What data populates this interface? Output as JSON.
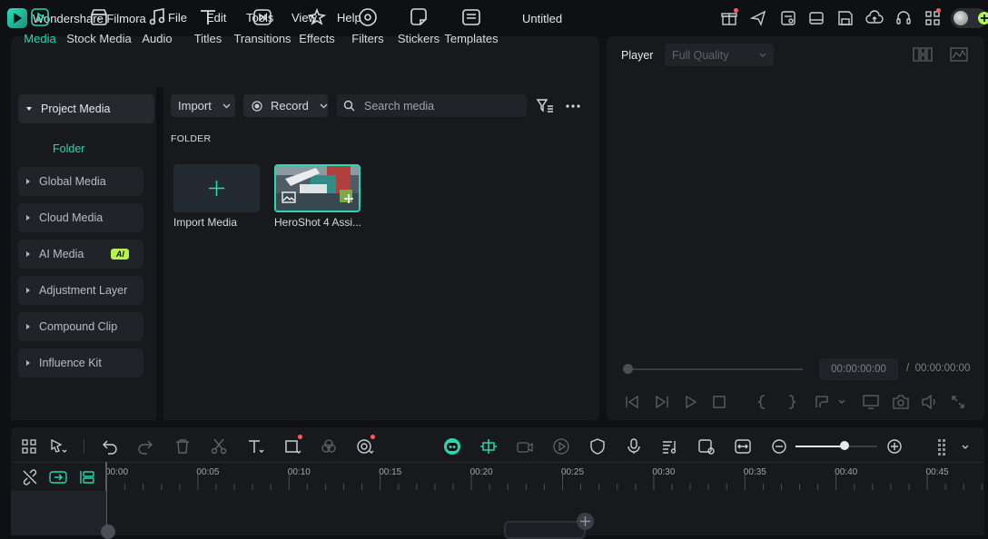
{
  "app": {
    "name": "Wondershare Filmora",
    "document_title": "Untitled"
  },
  "menu": {
    "file": "File",
    "edit": "Edit",
    "tools": "Tools",
    "view": "View",
    "help": "Help"
  },
  "tabs": [
    {
      "label": "Media",
      "active": true
    },
    {
      "label": "Stock Media"
    },
    {
      "label": "Audio"
    },
    {
      "label": "Titles"
    },
    {
      "label": "Transitions"
    },
    {
      "label": "Effects"
    },
    {
      "label": "Filters"
    },
    {
      "label": "Stickers"
    },
    {
      "label": "Templates"
    }
  ],
  "sidebar": {
    "project_media": "Project Media",
    "folder": "Folder",
    "global_media": "Global Media",
    "cloud_media": "Cloud Media",
    "ai_media": "AI Media",
    "ai_badge": "AI",
    "adjustment_layer": "Adjustment Layer",
    "compound_clip": "Compound Clip",
    "influence_kit": "Influence Kit"
  },
  "toolbar": {
    "import_label": "Import",
    "record_label": "Record",
    "search_placeholder": "Search media"
  },
  "media": {
    "folder_heading": "FOLDER",
    "import_tile_label": "Import Media",
    "clip_label": "HeroShot 4 Assi..."
  },
  "player": {
    "title": "Player",
    "quality": "Full Quality",
    "current_time": "00:00:00:00",
    "separator": "/",
    "total_time": "00:00:00:00"
  },
  "timeline": {
    "ruler": [
      "00:00",
      "00:05",
      "00:10",
      "00:15",
      "00:20",
      "00:25",
      "00:30",
      "00:35",
      "00:40",
      "00:45"
    ]
  },
  "colors": {
    "accent": "#29d7b1",
    "ai_badge": "#b4f251",
    "notify": "#ff5a5a",
    "panel": "#17191d",
    "background": "#0e1013"
  }
}
